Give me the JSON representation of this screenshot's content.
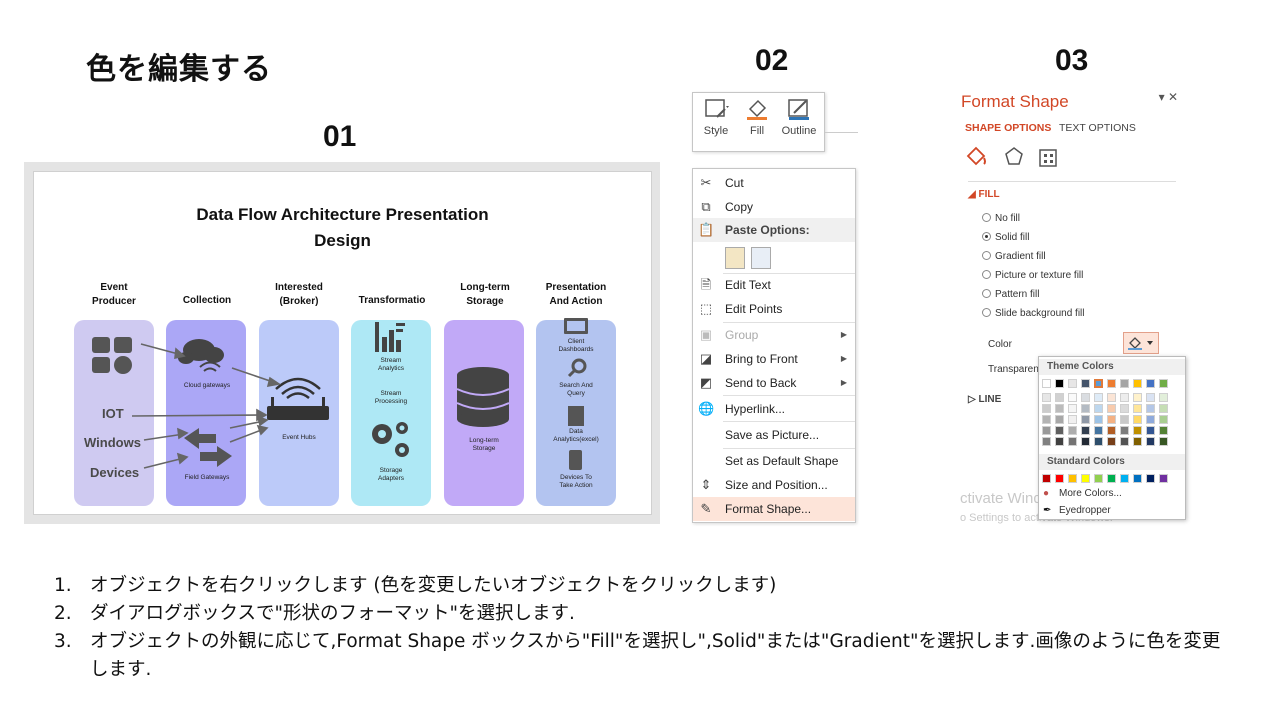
{
  "slide": {
    "title": "色を編集する",
    "step_labels": [
      "01",
      "02",
      "03"
    ]
  },
  "panel1": {
    "title_line1": "Data Flow Architecture Presentation",
    "title_line2": "Design",
    "columns": [
      {
        "head": "Event\nProducer",
        "color": "#cfcaf1"
      },
      {
        "head": "Collection",
        "color": "#aba7f6"
      },
      {
        "head": "Interested\n(Broker)",
        "color": "#bccaf9"
      },
      {
        "head": "Transformatio",
        "color": "#aee8f5"
      },
      {
        "head": "Long-term\nStorage",
        "color": "#c1a9f7"
      },
      {
        "head": "Presentation\nAnd Action",
        "color": "#b3c4f0"
      }
    ],
    "labels": {
      "cloud_gateways": "Cloud gateways",
      "field_gateways": "Field Gateways",
      "event_hubs": "Event Hubs",
      "stream_analytics": "Stream\nAnalytics",
      "stream_processing": "Stream\nProcessing",
      "storage_adapters": "Storage\nAdapters",
      "long_term_storage": "Long-term\nStorage",
      "client_dashboards": "Client\nDashboards",
      "search_query": "Search And\nQuery",
      "data_analytics": "Data\nAnalytics(excel)",
      "devices_action": "Devices To\nTake Action"
    },
    "producers": [
      "IOT",
      "Windows",
      "Devices"
    ]
  },
  "toolbar": {
    "style": "Style",
    "fill": "Fill",
    "outline": "Outline"
  },
  "context_menu": {
    "cut": "Cut",
    "copy": "Copy",
    "paste_options": "Paste Options:",
    "edit_text": "Edit Text",
    "edit_points": "Edit Points",
    "group": "Group",
    "bring_to_front": "Bring to Front",
    "send_to_back": "Send to Back",
    "hyperlink": "Hyperlink...",
    "save_as_picture": "Save as Picture...",
    "set_default_shape": "Set as Default Shape",
    "size_position": "Size and Position...",
    "format_shape": "Format Shape..."
  },
  "format_pane": {
    "title": "Format Shape",
    "tab_shape": "SHAPE OPTIONS",
    "tab_text": "TEXT OPTIONS",
    "fill_section": "FILL",
    "fill_options": [
      "No fill",
      "Solid fill",
      "Gradient fill",
      "Picture or texture fill",
      "Pattern fill",
      "Slide background fill"
    ],
    "selected_fill_index": 1,
    "color_label": "Color",
    "transparency_label": "Transparen",
    "line_section": "LINE",
    "watermark1": "ctivate Windows",
    "watermark2": "o Settings to activate Windows."
  },
  "palette": {
    "theme_colors_label": "Theme Colors",
    "standard_colors_label": "Standard Colors",
    "more_colors": "More Colors...",
    "eyedropper": "Eyedropper",
    "theme_row": [
      "#ffffff",
      "#000000",
      "#e7e6e6",
      "#44546a",
      "#5b9bd5",
      "#ed7d31",
      "#a5a5a5",
      "#ffc000",
      "#4472c4",
      "#70ad47"
    ],
    "standard_row": [
      "#c00000",
      "#ff0000",
      "#ffc000",
      "#ffff00",
      "#92d050",
      "#00b050",
      "#00b0f0",
      "#0070c0",
      "#002060",
      "#7030a0"
    ]
  },
  "instructions": [
    {
      "n": "1.",
      "text": "オブジェクトを右クリックします (色を変更したいオブジェクトをクリックします)"
    },
    {
      "n": "2.",
      "text": "ダイアログボックスで\"形状のフォーマット\"を選択します."
    },
    {
      "n": "3.",
      "text": "オブジェクトの外観に応じて,Format Shape ボックスから\"Fill\"を選択し\",Solid\"または\"Gradient\"を選択します.画像のように色を変更します."
    }
  ]
}
